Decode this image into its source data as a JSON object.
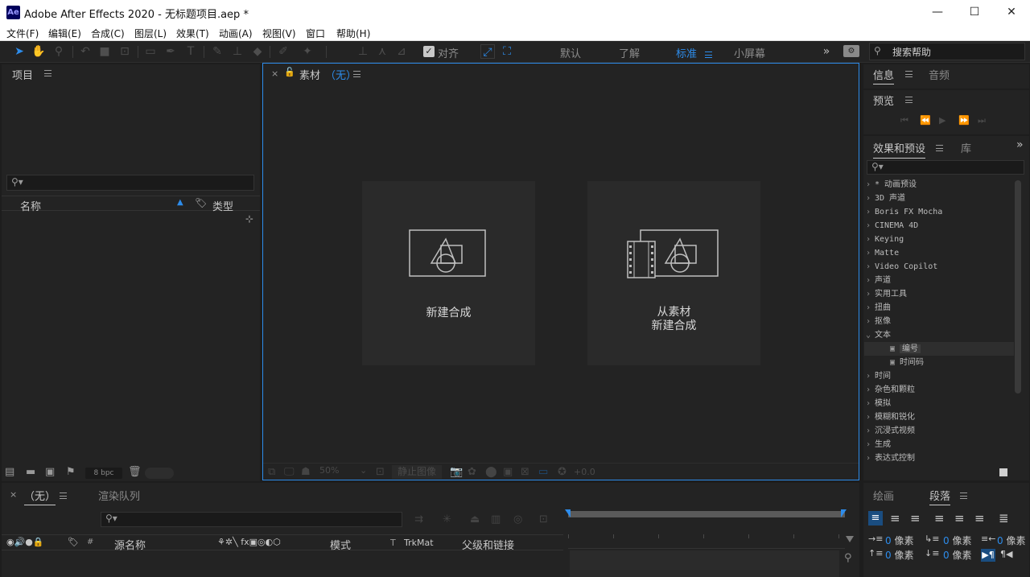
{
  "app": {
    "icon_text": "Ae",
    "title": "Adobe After Effects 2020 - 无标题项目.aep *"
  },
  "window_controls": {
    "minimize": "—",
    "maximize": "☐",
    "close": "✕"
  },
  "menu": [
    "文件(F)",
    "编辑(E)",
    "合成(C)",
    "图层(L)",
    "效果(T)",
    "动画(A)",
    "视图(V)",
    "窗口",
    "帮助(H)"
  ],
  "toolbar": {
    "align_label": "对齐",
    "workspaces": [
      "默认",
      "了解",
      "标准",
      "小屏幕"
    ],
    "active_workspace": "标准",
    "search_placeholder": "搜索帮助"
  },
  "project": {
    "title": "项目",
    "col_name": "名称",
    "col_type": "类型",
    "bpc": "8 bpc"
  },
  "viewer": {
    "tab": "素材",
    "tab_suffix": "（无）",
    "card_new_comp": "新建合成",
    "card_from_footage_line1": "从素材",
    "card_from_footage_line2": "新建合成",
    "zoom": "50%",
    "freeze": "静止图像",
    "exposure": "+0.0"
  },
  "right": {
    "info_tab": "信息",
    "audio_tab": "音频",
    "preview_title": "预览",
    "efx_tab": "效果和预设",
    "lib_tab": "库",
    "efx_items": [
      "* 动画预设",
      "3D 声道",
      "Boris FX Mocha",
      "CINEMA 4D",
      "Keying",
      "Matte",
      "Video Copilot",
      "声道",
      "实用工具",
      "扭曲",
      "抠像",
      "文本"
    ],
    "efx_sub": [
      "编号",
      "时间码"
    ],
    "efx_items2": [
      "时间",
      "杂色和颗粒",
      "模拟",
      "模糊和锐化",
      "沉浸式视频",
      "生成",
      "表达式控制"
    ]
  },
  "timeline": {
    "tab": "（无）",
    "render_tab": "渲染队列",
    "col_hash": "#",
    "col_source": "源名称",
    "col_mode": "模式",
    "col_t": "T",
    "col_trkmat": "TrkMat",
    "col_parent": "父级和链接"
  },
  "paragraph": {
    "draw_tab": "绘画",
    "para_tab": "段落",
    "indent_value": "0 像素"
  },
  "colors": {
    "accent": "#2d8ceb",
    "panel": "#232323",
    "bg": "#1d1d1d"
  }
}
